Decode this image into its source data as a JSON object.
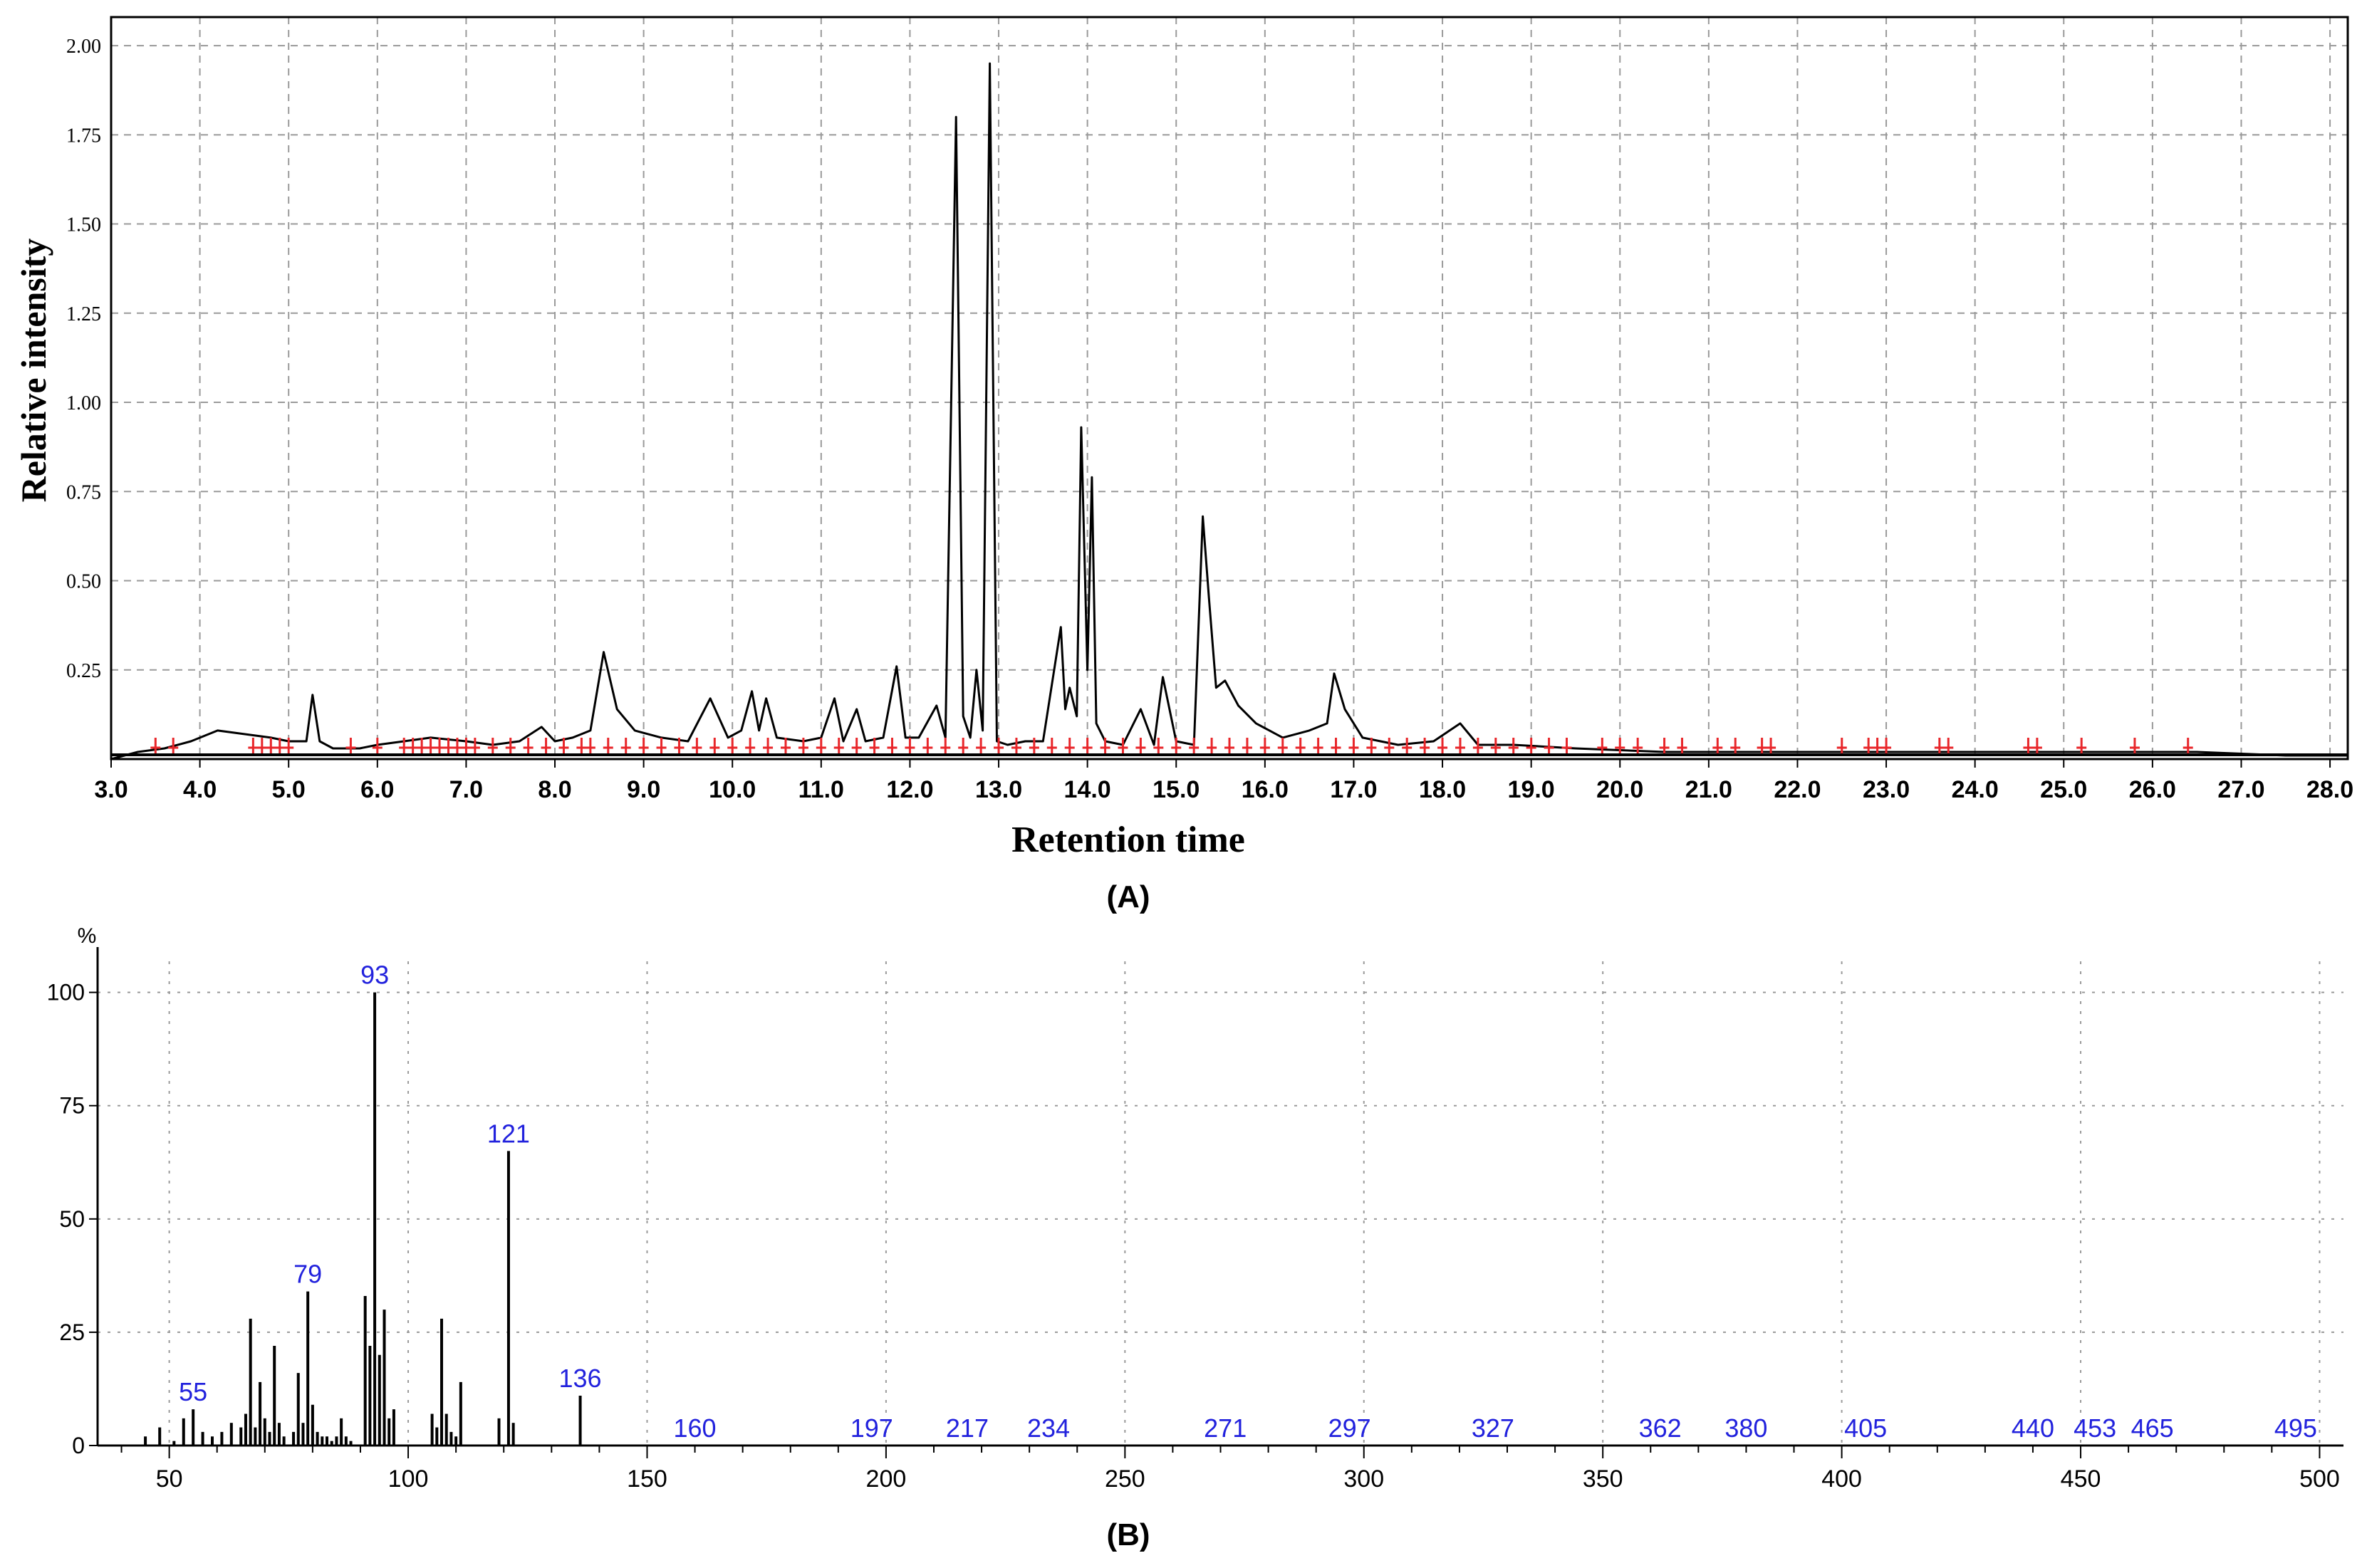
{
  "chart_data": [
    {
      "type": "line",
      "title": "",
      "xlabel": "Retention time",
      "ylabel": "Relative intensity",
      "panel_label": "(A)",
      "xlim": [
        3.0,
        28.2
      ],
      "ylim": [
        0,
        2.08
      ],
      "x_ticks": [
        "3.0",
        "4.0",
        "5.0",
        "6.0",
        "7.0",
        "8.0",
        "9.0",
        "10.0",
        "11.0",
        "12.0",
        "13.0",
        "14.0",
        "15.0",
        "16.0",
        "17.0",
        "18.0",
        "19.0",
        "20.0",
        "21.0",
        "22.0",
        "23.0",
        "24.0",
        "25.0",
        "26.0",
        "27.0",
        "28.0"
      ],
      "y_ticks": [
        "0.25",
        "0.50",
        "0.75",
        "1.00",
        "1.25",
        "1.50",
        "1.75",
        "2.00"
      ],
      "grid": true,
      "line_color": "#000000",
      "marker_color": "#e8262a",
      "series": [
        {
          "x": [
            3.0,
            3.3,
            3.6,
            3.9,
            4.2,
            4.5,
            4.8,
            5.0,
            5.2,
            5.27,
            5.35,
            5.5,
            5.8,
            6.0,
            6.3,
            6.6,
            7.0,
            7.3,
            7.6,
            7.85,
            8.0,
            8.2,
            8.4,
            8.55,
            8.7,
            8.9,
            9.2,
            9.5,
            9.75,
            9.95,
            10.1,
            10.22,
            10.3,
            10.38,
            10.5,
            10.8,
            11.0,
            11.15,
            11.25,
            11.4,
            11.5,
            11.7,
            11.85,
            11.95,
            12.1,
            12.3,
            12.4,
            12.52,
            12.6,
            12.68,
            12.75,
            12.82,
            12.9,
            12.98,
            13.1,
            13.3,
            13.5,
            13.7,
            13.75,
            13.8,
            13.88,
            13.93,
            14.0,
            14.05,
            14.1,
            14.2,
            14.4,
            14.6,
            14.75,
            14.85,
            15.0,
            15.2,
            15.3,
            15.37,
            15.45,
            15.55,
            15.7,
            15.9,
            16.2,
            16.5,
            16.7,
            16.78,
            16.9,
            17.1,
            17.5,
            17.9,
            18.2,
            18.4,
            18.8,
            19.5,
            20.5,
            21.5,
            22.5,
            23.5,
            24.5,
            25.5,
            26.5,
            27.5,
            28.2
          ],
          "y": [
            0.0,
            0.02,
            0.03,
            0.05,
            0.08,
            0.07,
            0.06,
            0.05,
            0.05,
            0.18,
            0.05,
            0.03,
            0.03,
            0.04,
            0.05,
            0.06,
            0.05,
            0.04,
            0.05,
            0.09,
            0.05,
            0.06,
            0.08,
            0.3,
            0.14,
            0.08,
            0.06,
            0.05,
            0.17,
            0.06,
            0.08,
            0.19,
            0.08,
            0.17,
            0.06,
            0.05,
            0.06,
            0.17,
            0.05,
            0.14,
            0.05,
            0.06,
            0.26,
            0.06,
            0.06,
            0.15,
            0.06,
            1.8,
            0.12,
            0.06,
            0.25,
            0.08,
            1.95,
            0.05,
            0.04,
            0.05,
            0.05,
            0.37,
            0.14,
            0.2,
            0.12,
            0.93,
            0.25,
            0.79,
            0.1,
            0.05,
            0.04,
            0.14,
            0.04,
            0.23,
            0.05,
            0.04,
            0.68,
            0.45,
            0.2,
            0.22,
            0.15,
            0.1,
            0.06,
            0.08,
            0.1,
            0.24,
            0.14,
            0.06,
            0.04,
            0.05,
            0.1,
            0.04,
            0.04,
            0.03,
            0.02,
            0.02,
            0.02,
            0.02,
            0.02,
            0.02,
            0.02,
            0.01,
            0.01
          ]
        }
      ],
      "peak_markers_x": [
        3.5,
        3.7,
        4.6,
        4.7,
        4.8,
        4.9,
        5.0,
        5.7,
        6.0,
        6.3,
        6.4,
        6.5,
        6.6,
        6.7,
        6.8,
        6.9,
        7.0,
        7.1,
        7.3,
        7.5,
        7.7,
        7.9,
        8.1,
        8.3,
        8.4,
        8.6,
        8.8,
        9.0,
        9.2,
        9.4,
        9.6,
        9.8,
        10.0,
        10.2,
        10.4,
        10.6,
        10.8,
        11.0,
        11.2,
        11.4,
        11.6,
        11.8,
        12.0,
        12.2,
        12.4,
        12.6,
        12.8,
        13.0,
        13.2,
        13.4,
        13.6,
        13.8,
        14.0,
        14.2,
        14.4,
        14.6,
        14.8,
        15.0,
        15.2,
        15.4,
        15.6,
        15.8,
        16.0,
        16.2,
        16.4,
        16.6,
        16.8,
        17.0,
        17.2,
        17.4,
        17.6,
        17.8,
        18.0,
        18.2,
        18.4,
        18.6,
        18.8,
        19.0,
        19.2,
        19.4,
        19.8,
        20.0,
        20.2,
        20.5,
        20.7,
        21.1,
        21.3,
        21.6,
        21.7,
        22.5,
        22.8,
        22.9,
        23.0,
        23.6,
        23.7,
        24.6,
        24.7,
        25.2,
        25.8,
        26.4
      ]
    },
    {
      "type": "bar",
      "title": "",
      "xlabel": "",
      "ylabel": "%",
      "panel_label": "(B)",
      "xlim": [
        35,
        505
      ],
      "ylim": [
        0,
        110
      ],
      "x_ticks": [
        "50",
        "100",
        "150",
        "200",
        "250",
        "300",
        "350",
        "400",
        "450",
        "500"
      ],
      "y_ticks": [
        "0",
        "25",
        "50",
        "75",
        "100"
      ],
      "grid": true,
      "line_color": "#000000",
      "label_color": "#2222dd",
      "mz": [
        45,
        48,
        51,
        53,
        55,
        57,
        59,
        61,
        63,
        65,
        66,
        67,
        68,
        69,
        70,
        71,
        72,
        73,
        74,
        76,
        77,
        78,
        79,
        80,
        81,
        82,
        83,
        84,
        85,
        86,
        87,
        88,
        91,
        92,
        93,
        94,
        95,
        96,
        97,
        105,
        106,
        107,
        108,
        109,
        110,
        111,
        119,
        121,
        122,
        136
      ],
      "intensity": [
        2,
        4,
        1,
        6,
        8,
        3,
        2,
        3,
        5,
        4,
        7,
        28,
        4,
        14,
        6,
        3,
        22,
        5,
        2,
        3,
        16,
        5,
        34,
        9,
        3,
        2,
        2,
        1,
        2,
        6,
        2,
        1,
        33,
        22,
        100,
        20,
        30,
        6,
        8,
        7,
        4,
        28,
        7,
        3,
        2,
        14,
        6,
        65,
        5,
        11
      ],
      "labels": [
        {
          "text": "55",
          "mz": 55,
          "y": 8
        },
        {
          "text": "79",
          "mz": 79,
          "y": 34
        },
        {
          "text": "93",
          "mz": 93,
          "y": 100
        },
        {
          "text": "121",
          "mz": 121,
          "y": 65
        },
        {
          "text": "136",
          "mz": 136,
          "y": 11
        },
        {
          "text": "160",
          "mz": 160,
          "y": 0
        },
        {
          "text": "197",
          "mz": 197,
          "y": 0
        },
        {
          "text": "217",
          "mz": 217,
          "y": 0
        },
        {
          "text": "234",
          "mz": 234,
          "y": 0
        },
        {
          "text": "271",
          "mz": 271,
          "y": 0
        },
        {
          "text": "297",
          "mz": 297,
          "y": 0
        },
        {
          "text": "327",
          "mz": 327,
          "y": 0
        },
        {
          "text": "362",
          "mz": 362,
          "y": 0
        },
        {
          "text": "380",
          "mz": 380,
          "y": 0
        },
        {
          "text": "405",
          "mz": 405,
          "y": 0
        },
        {
          "text": "440",
          "mz": 440,
          "y": 0
        },
        {
          "text": "453",
          "mz": 453,
          "y": 0
        },
        {
          "text": "465",
          "mz": 465,
          "y": 0
        },
        {
          "text": "495",
          "mz": 495,
          "y": 0
        }
      ]
    }
  ]
}
